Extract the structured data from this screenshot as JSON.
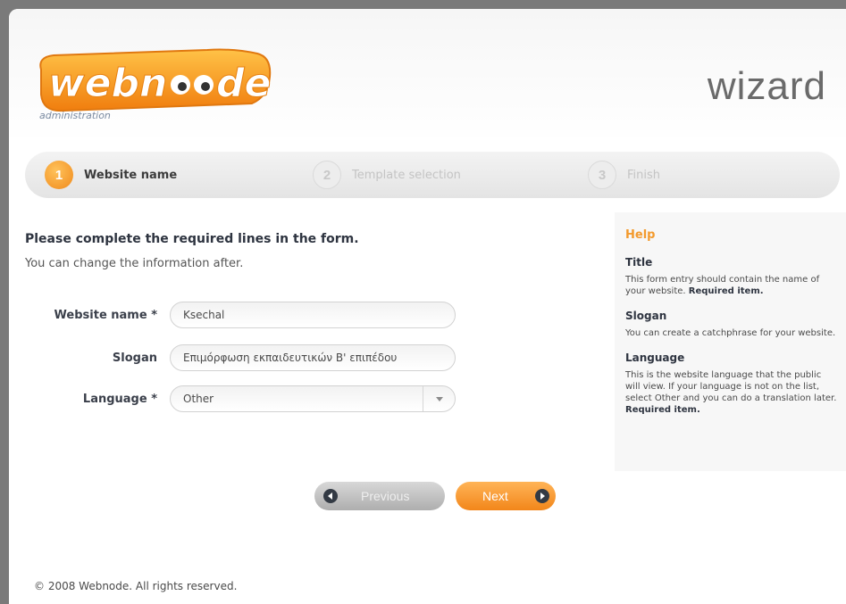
{
  "header": {
    "logo_text": "webnode",
    "logo_sub": "administration",
    "title": "wizard"
  },
  "steps": [
    {
      "number": "1",
      "label": "Website name",
      "active": true
    },
    {
      "number": "2",
      "label": "Template selection",
      "active": false
    },
    {
      "number": "3",
      "label": "Finish",
      "active": false
    }
  ],
  "form": {
    "title": "Please complete the required lines in the form.",
    "subtitle": "You can change the information after.",
    "fields": {
      "website_name": {
        "label": "Website name *",
        "value": "Ksechal"
      },
      "slogan": {
        "label": "Slogan",
        "value": "Επιμόρφωση εκπαιδευτικών Β' επιπέδου"
      },
      "language": {
        "label": "Language *",
        "value": "Other"
      }
    },
    "buttons": {
      "previous": "Previous",
      "next": "Next"
    }
  },
  "help": {
    "title": "Help",
    "sections": [
      {
        "head": "Title",
        "text": "This form entry should contain the name of your website.",
        "required": "Required item."
      },
      {
        "head": "Slogan",
        "text": "You can create a catchphrase for your website.",
        "required": ""
      },
      {
        "head": "Language",
        "text": "This is the website language that the public will view. If your language is not on the list, select Other and you can do a translation later.",
        "required": "Required item."
      }
    ]
  },
  "footer": {
    "copyright": "© 2008 Webnode. All rights reserved."
  },
  "colors": {
    "accent_orange": "#f39a2d",
    "heading_dark": "#2e3440",
    "button_next": "#f2861a",
    "button_previous": "#aeaeae"
  },
  "icons": {
    "previous": "chevron-left-circle-icon",
    "next": "chevron-right-circle-icon",
    "select": "chevron-down-icon"
  }
}
